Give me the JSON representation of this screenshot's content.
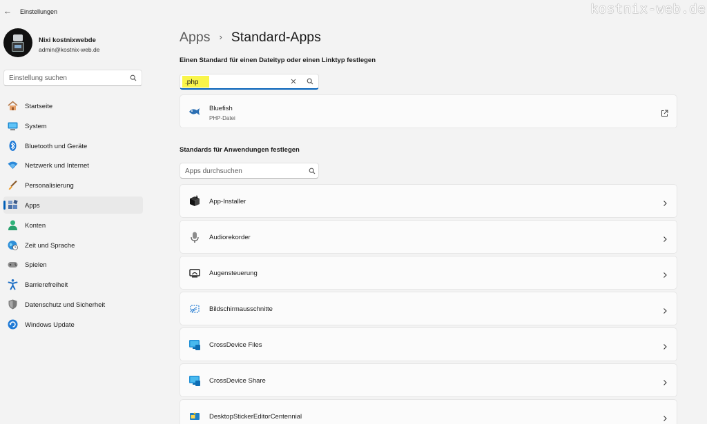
{
  "window": {
    "title": "Einstellungen",
    "back_icon": "back-arrow-icon"
  },
  "watermark": "kostnix-web.de",
  "profile": {
    "name": "Nixi kostnixwebde",
    "email": "admin@kostnix-web.de"
  },
  "sidebar_search": {
    "placeholder": "Einstellung suchen",
    "value": ""
  },
  "nav": [
    {
      "label": "Startseite",
      "icon": "home-icon",
      "active": false
    },
    {
      "label": "System",
      "icon": "monitor-icon",
      "active": false
    },
    {
      "label": "Bluetooth und Geräte",
      "icon": "bluetooth-icon",
      "active": false
    },
    {
      "label": "Netzwerk und Internet",
      "icon": "wifi-icon",
      "active": false
    },
    {
      "label": "Personalisierung",
      "icon": "brush-icon",
      "active": false
    },
    {
      "label": "Apps",
      "icon": "apps-icon",
      "active": true
    },
    {
      "label": "Konten",
      "icon": "person-icon",
      "active": false
    },
    {
      "label": "Zeit und Sprache",
      "icon": "globe-clock-icon",
      "active": false
    },
    {
      "label": "Spielen",
      "icon": "gamepad-icon",
      "active": false
    },
    {
      "label": "Barrierefreiheit",
      "icon": "accessibility-icon",
      "active": false
    },
    {
      "label": "Datenschutz und Sicherheit",
      "icon": "shield-icon",
      "active": false
    },
    {
      "label": "Windows Update",
      "icon": "update-icon",
      "active": false
    }
  ],
  "breadcrumb": {
    "parent": "Apps",
    "separator": "›",
    "current": "Standard-Apps"
  },
  "filetype_section": {
    "title": "Einen Standard für einen Dateityp oder einen Linktyp festlegen",
    "input_value": ".php",
    "result": {
      "name": "Bluefish",
      "subtitle": "PHP-Datei",
      "icon": "bluefish-icon"
    }
  },
  "apps_section": {
    "title": "Standards für Anwendungen festlegen",
    "search_placeholder": "Apps durchsuchen",
    "apps": [
      {
        "name": "App-Installer",
        "icon": "box-icon"
      },
      {
        "name": "Audiorekorder",
        "icon": "microphone-icon"
      },
      {
        "name": "Augensteuerung",
        "icon": "eye-control-icon"
      },
      {
        "name": "Bildschirmausschnitte",
        "icon": "snip-icon"
      },
      {
        "name": "CrossDevice Files",
        "icon": "crossdevice-icon"
      },
      {
        "name": "CrossDevice Share",
        "icon": "crossdevice-icon"
      },
      {
        "name": "DesktopStickerEditorCentennial",
        "icon": "sticker-icon"
      }
    ]
  }
}
